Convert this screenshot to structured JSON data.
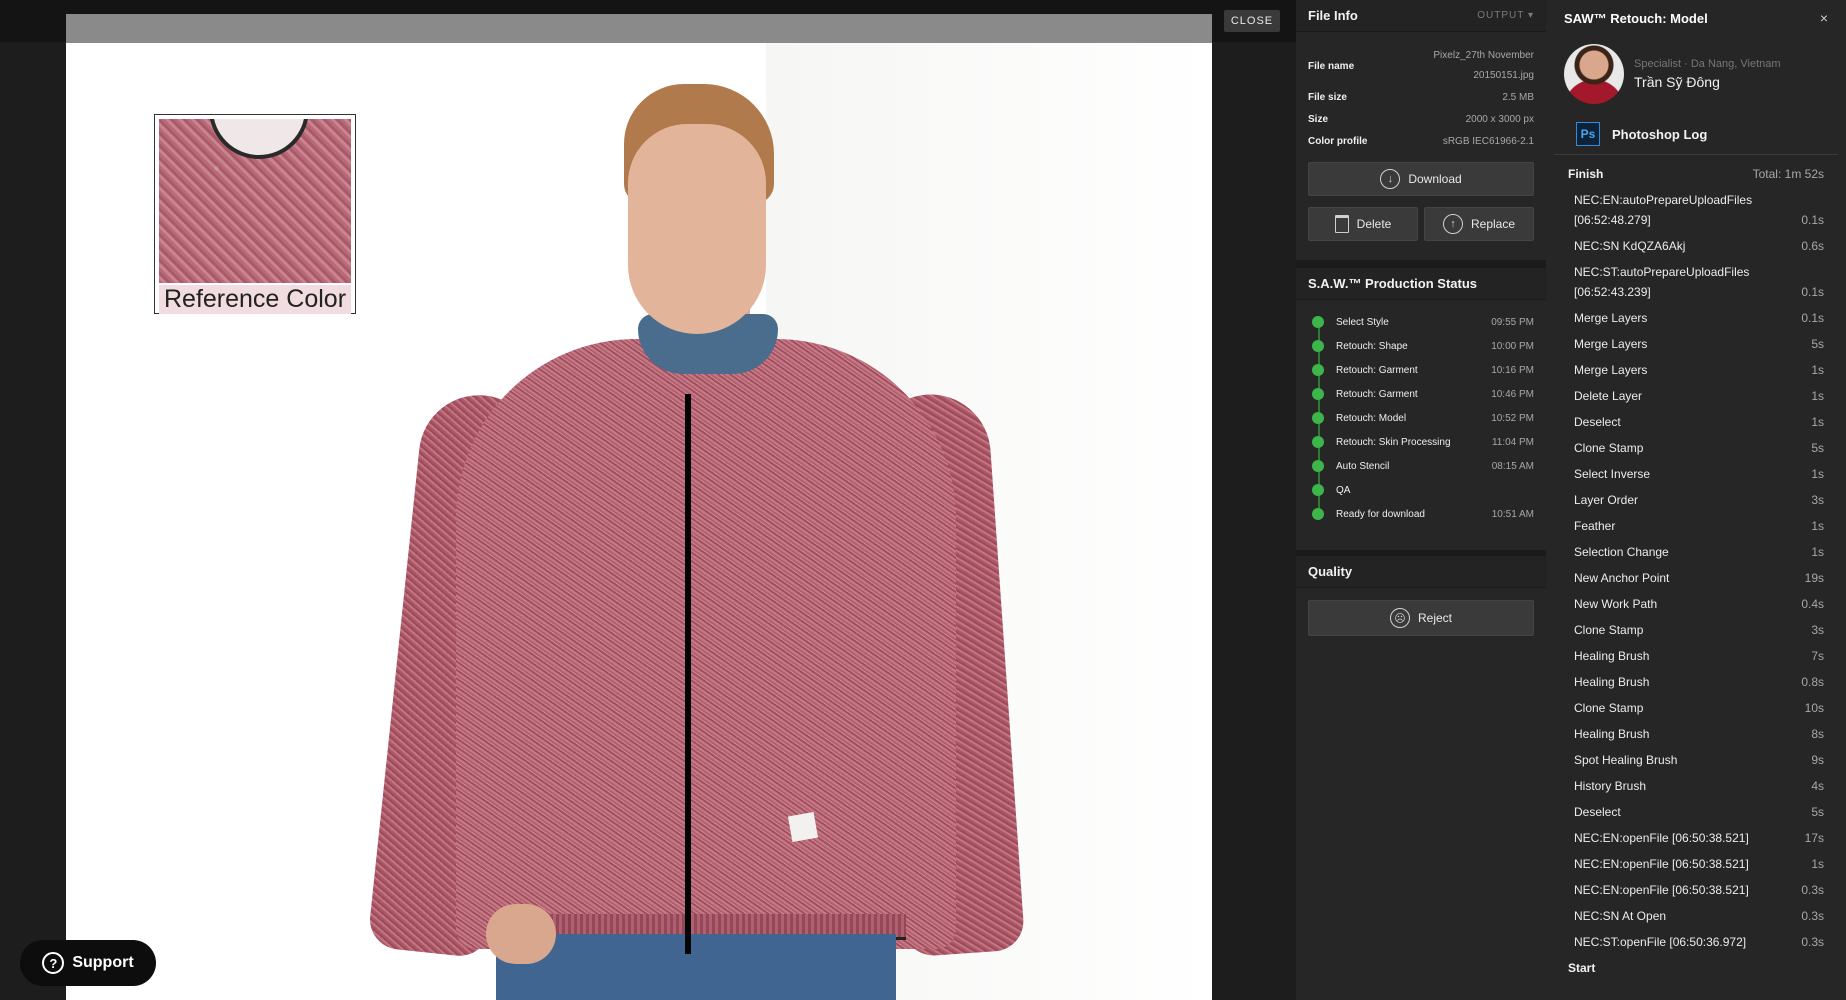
{
  "viewer": {
    "close_label": "CLOSE",
    "reference_label": "Reference Color",
    "support_label": "Support",
    "support_icon": "question-icon"
  },
  "file_info": {
    "title": "File Info",
    "output_label": "OUTPUT",
    "file_name_label": "File name",
    "file_name_line1": "Pixelz_27th November",
    "file_name_line2": "20150151.jpg",
    "file_size_label": "File size",
    "file_size": "2.5 MB",
    "size_label": "Size",
    "size": "2000 x 3000 px",
    "color_profile_label": "Color profile",
    "color_profile": "sRGB IEC61966-2.1",
    "download_label": "Download",
    "delete_label": "Delete",
    "replace_label": "Replace"
  },
  "production_status": {
    "title": "S.A.W.™ Production Status",
    "steps": [
      {
        "label": "Select Style",
        "time": "09:55 PM"
      },
      {
        "label": "Retouch: Shape",
        "time": "10:00 PM"
      },
      {
        "label": "Retouch: Garment",
        "time": "10:16 PM"
      },
      {
        "label": "Retouch: Garment",
        "time": "10:46 PM"
      },
      {
        "label": "Retouch: Model",
        "time": "10:52 PM"
      },
      {
        "label": "Retouch: Skin Processing",
        "time": "11:04 PM"
      },
      {
        "label": "Auto Stencil",
        "time": "08:15 AM"
      },
      {
        "label": "QA",
        "time": ""
      },
      {
        "label": "Ready for download",
        "time": "10:51 AM"
      }
    ],
    "status_color": "#3cb54a"
  },
  "quality": {
    "title": "Quality",
    "reject_label": "Reject"
  },
  "log": {
    "title": "SAW™ Retouch: Model",
    "close_glyph": "×",
    "specialist_role": "Specialist · Da Nang, Vietnam",
    "specialist_name": "Trần Sỹ Đông",
    "photoshop_icon_text": "Ps",
    "photoshop_log_title": "Photoshop Log",
    "finish_label": "Finish",
    "total": "Total: 1m 52s",
    "entries": [
      {
        "name": "NEC:EN:autoPrepareUploadFiles [06:52:48.279]",
        "duration": "0.1s"
      },
      {
        "name": "NEC:SN KdQZA6Akj",
        "duration": "0.6s"
      },
      {
        "name": "NEC:ST:autoPrepareUploadFiles [06:52:43.239]",
        "duration": "0.1s"
      },
      {
        "name": "Merge Layers",
        "duration": "0.1s"
      },
      {
        "name": "Merge Layers",
        "duration": "5s"
      },
      {
        "name": "Merge Layers",
        "duration": "1s"
      },
      {
        "name": "Delete Layer",
        "duration": "1s"
      },
      {
        "name": "Deselect",
        "duration": "1s"
      },
      {
        "name": "Clone Stamp",
        "duration": "5s"
      },
      {
        "name": "Select Inverse",
        "duration": "1s"
      },
      {
        "name": "Layer Order",
        "duration": "3s"
      },
      {
        "name": "Feather",
        "duration": "1s"
      },
      {
        "name": "Selection Change",
        "duration": "1s"
      },
      {
        "name": "New Anchor Point",
        "duration": "19s"
      },
      {
        "name": "New Work Path",
        "duration": "0.4s"
      },
      {
        "name": "Clone Stamp",
        "duration": "3s"
      },
      {
        "name": "Healing Brush",
        "duration": "7s"
      },
      {
        "name": "Healing Brush",
        "duration": "0.8s"
      },
      {
        "name": "Clone Stamp",
        "duration": "10s"
      },
      {
        "name": "Healing Brush",
        "duration": "8s"
      },
      {
        "name": "Spot Healing Brush",
        "duration": "9s"
      },
      {
        "name": "History Brush",
        "duration": "4s"
      },
      {
        "name": "Deselect",
        "duration": "5s"
      },
      {
        "name": "NEC:EN:openFile [06:50:38.521]",
        "duration": "17s"
      },
      {
        "name": "NEC:EN:openFile [06:50:38.521]",
        "duration": "1s"
      },
      {
        "name": "NEC:EN:openFile [06:50:38.521]",
        "duration": "0.3s"
      },
      {
        "name": "NEC:SN At Open",
        "duration": "0.3s"
      },
      {
        "name": "NEC:ST:openFile [06:50:36.972]",
        "duration": "0.3s"
      }
    ],
    "start_label": "Start"
  }
}
